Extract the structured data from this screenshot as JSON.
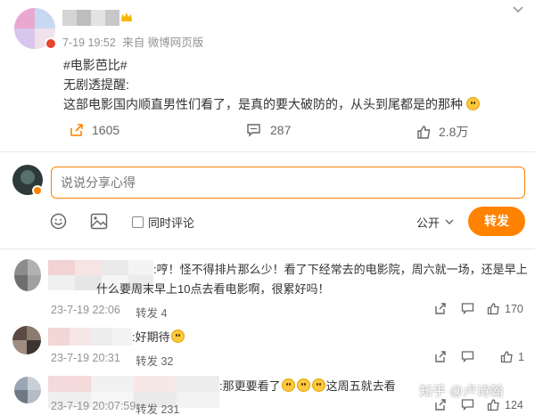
{
  "post": {
    "meta_time": "7-19 19:52",
    "meta_from": "来自 微博网页版",
    "topic": "#电影芭比#",
    "line1": "无剧透提醒:",
    "line2": "这部电影国内顺直男性们看了，是真的要大破防的，从头到尾都是的那种",
    "repost_count": "1605",
    "comment_count": "287",
    "like_count": "2.8万"
  },
  "reply": {
    "placeholder": "说说分享心得",
    "also_comment_label": "同时评论",
    "visibility": "公开",
    "send_label": "转发"
  },
  "comments": [
    {
      "line1": ":哼！怪不得排片那么少！看了下经常去的电影院，周六就一场，还是早上",
      "line2": "什么要周末早上10点去看电影啊，很累好吗！",
      "time": "23-7-19 22:06",
      "repost": "转发 4",
      "likes": "170"
    },
    {
      "line1": ":好期待",
      "time": "23-7-19 20:31",
      "repost": "转发 32",
      "likes": "1"
    },
    {
      "line1_a": ":那更要看了",
      "line1_b": "这周五就去看",
      "time": "23-7-19 20:07:59",
      "repost": "转发 231",
      "likes": "124"
    }
  ],
  "watermark": "知乎 @卢诗翰",
  "colors": {
    "accent": "#ff8200",
    "meta_gray": "#939393",
    "text": "#333333"
  },
  "icons": [
    "chevron-down-icon",
    "crown-icon",
    "verified-badge-icon",
    "repost-icon",
    "comment-icon",
    "like-icon",
    "emoji-icon",
    "image-icon",
    "checkbox-icon",
    "dropdown-icon"
  ]
}
